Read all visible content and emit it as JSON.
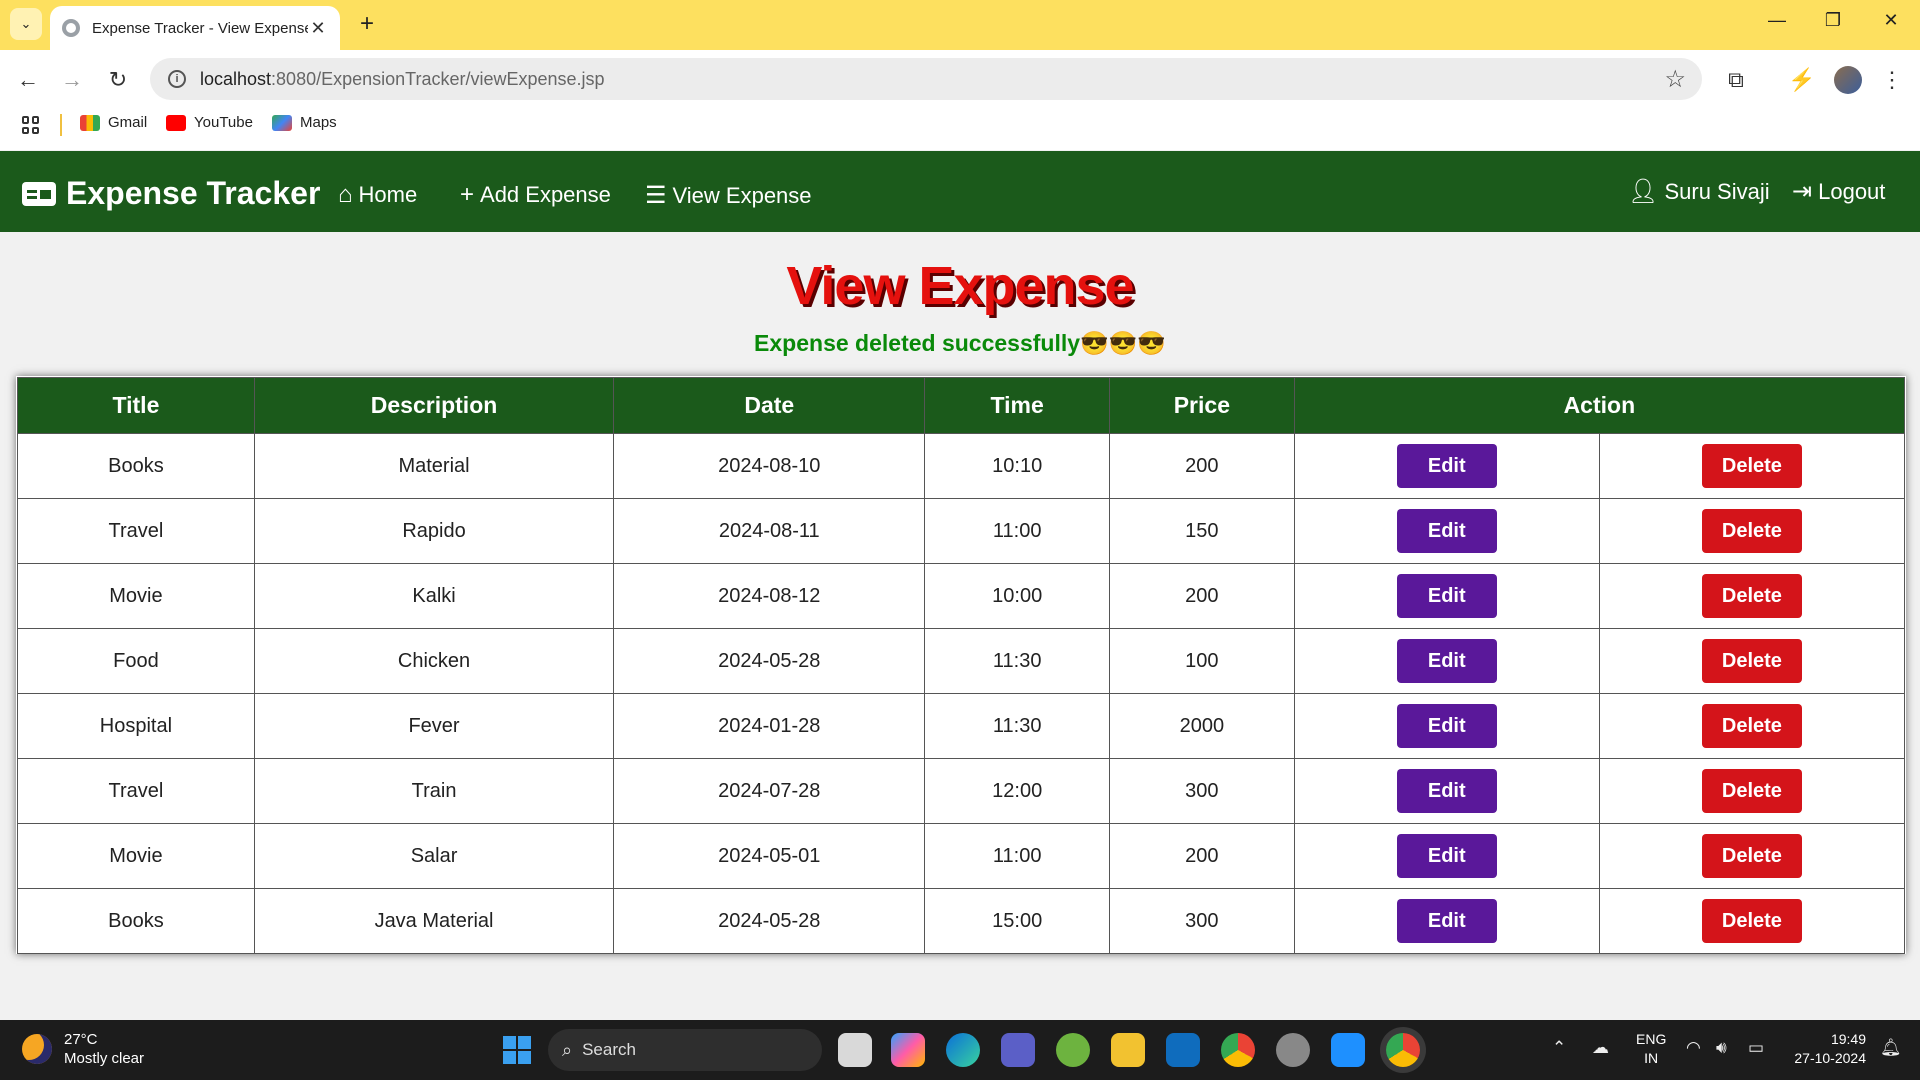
{
  "browser": {
    "tab_title": "Expense Tracker - View Expense",
    "url_host": "localhost",
    "url_path": ":8080/ExpensionTracker/viewExpense.jsp",
    "bookmarks": [
      "Gmail",
      "YouTube",
      "Maps"
    ]
  },
  "navbar": {
    "brand": "Expense Tracker",
    "links": [
      "Home",
      "Add Expense",
      "View Expense"
    ],
    "user": "Suru Sivaji",
    "logout": "Logout"
  },
  "page": {
    "title": "View Expense",
    "message": "Expense deleted successfully😎😎😎"
  },
  "table": {
    "headers": [
      "Title",
      "Description",
      "Date",
      "Time",
      "Price",
      "Action"
    ],
    "edit_label": "Edit",
    "delete_label": "Delete",
    "rows": [
      [
        "Books",
        "Material",
        "2024-08-10",
        "10:10",
        "200"
      ],
      [
        "Travel",
        "Rapido",
        "2024-08-11",
        "11:00",
        "150"
      ],
      [
        "Movie",
        "Kalki",
        "2024-08-12",
        "10:00",
        "200"
      ],
      [
        "Food",
        "Chicken",
        "2024-05-28",
        "11:30",
        "100"
      ],
      [
        "Hospital",
        "Fever",
        "2024-01-28",
        "11:30",
        "2000"
      ],
      [
        "Travel",
        "Train",
        "2024-07-28",
        "12:00",
        "300"
      ],
      [
        "Movie",
        "Salar",
        "2024-05-01",
        "11:00",
        "200"
      ],
      [
        "Books",
        "Java Material",
        "2024-05-28",
        "15:00",
        "300"
      ]
    ]
  },
  "taskbar": {
    "temperature": "27°C",
    "weather": "Mostly clear",
    "search_placeholder": "Search",
    "lang_1": "ENG",
    "lang_2": "IN",
    "time": "19:49",
    "date": "27-10-2024"
  },
  "colors": {
    "navbar_bg": "#1b5a1b",
    "edit_button": "#5a189a",
    "delete_button": "#d4141a",
    "title_red": "#e5110e",
    "success_green": "#0a8a0a"
  }
}
